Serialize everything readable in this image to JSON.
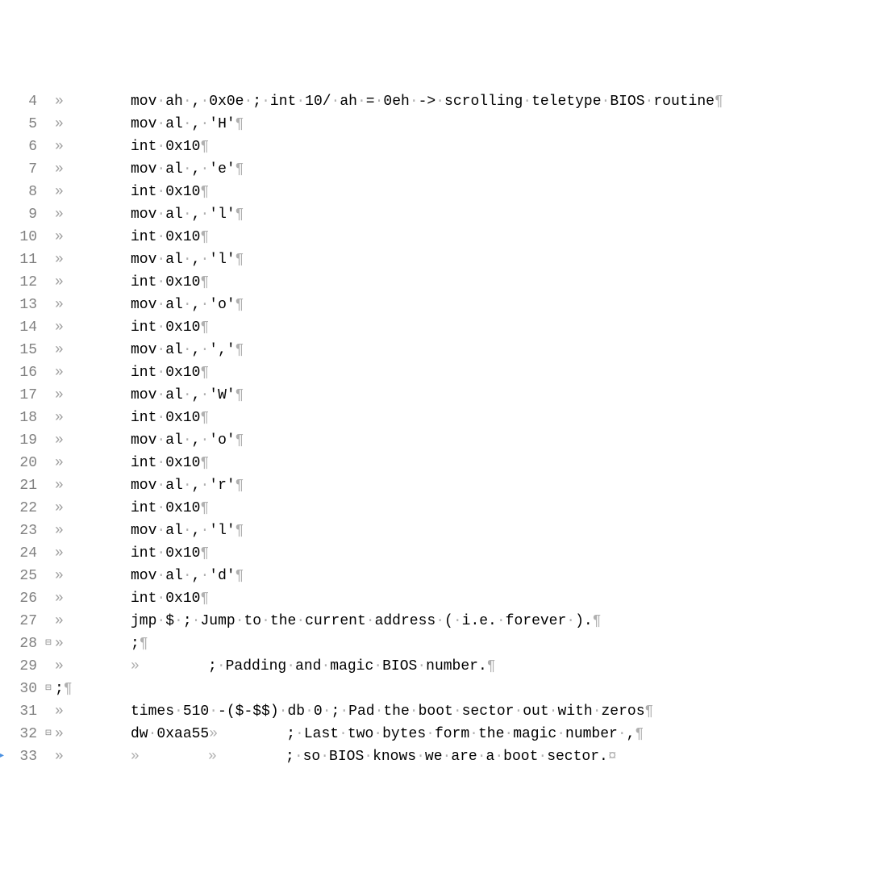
{
  "lines": [
    {
      "num": "4",
      "fold": "",
      "marker": "",
      "tab": "»",
      "tokens": [
        "mov",
        "·",
        "ah",
        "·",
        ",",
        "·",
        "0x0e",
        "·",
        ";",
        "·",
        "int",
        "·",
        "10/",
        "·",
        "ah",
        "·",
        "=",
        "·",
        "0eh",
        "·",
        "->",
        "·",
        "scrolling",
        "·",
        "teletype",
        "·",
        "BIOS",
        "·",
        "routine"
      ],
      "eol": "¶"
    },
    {
      "num": "5",
      "fold": "",
      "marker": "",
      "tab": "»",
      "tokens": [
        "mov",
        "·",
        "al",
        "·",
        ",",
        "·",
        "'H'"
      ],
      "eol": "¶"
    },
    {
      "num": "6",
      "fold": "",
      "marker": "",
      "tab": "»",
      "tokens": [
        "int",
        "·",
        "0x10"
      ],
      "eol": "¶"
    },
    {
      "num": "7",
      "fold": "",
      "marker": "",
      "tab": "»",
      "tokens": [
        "mov",
        "·",
        "al",
        "·",
        ",",
        "·",
        "'e'"
      ],
      "eol": "¶"
    },
    {
      "num": "8",
      "fold": "",
      "marker": "",
      "tab": "»",
      "tokens": [
        "int",
        "·",
        "0x10"
      ],
      "eol": "¶"
    },
    {
      "num": "9",
      "fold": "",
      "marker": "",
      "tab": "»",
      "tokens": [
        "mov",
        "·",
        "al",
        "·",
        ",",
        "·",
        "'l'"
      ],
      "eol": "¶"
    },
    {
      "num": "10",
      "fold": "",
      "marker": "",
      "tab": "»",
      "tokens": [
        "int",
        "·",
        "0x10"
      ],
      "eol": "¶"
    },
    {
      "num": "11",
      "fold": "",
      "marker": "",
      "tab": "»",
      "tokens": [
        "mov",
        "·",
        "al",
        "·",
        ",",
        "·",
        "'l'"
      ],
      "eol": "¶"
    },
    {
      "num": "12",
      "fold": "",
      "marker": "",
      "tab": "»",
      "tokens": [
        "int",
        "·",
        "0x10"
      ],
      "eol": "¶"
    },
    {
      "num": "13",
      "fold": "",
      "marker": "",
      "tab": "»",
      "tokens": [
        "mov",
        "·",
        "al",
        "·",
        ",",
        "·",
        "'o'"
      ],
      "eol": "¶"
    },
    {
      "num": "14",
      "fold": "",
      "marker": "",
      "tab": "»",
      "tokens": [
        "int",
        "·",
        "0x10"
      ],
      "eol": "¶"
    },
    {
      "num": "15",
      "fold": "",
      "marker": "",
      "tab": "»",
      "tokens": [
        "mov",
        "·",
        "al",
        "·",
        ",",
        "·",
        "','"
      ],
      "eol": "¶"
    },
    {
      "num": "16",
      "fold": "",
      "marker": "",
      "tab": "»",
      "tokens": [
        "int",
        "·",
        "0x10"
      ],
      "eol": "¶"
    },
    {
      "num": "17",
      "fold": "",
      "marker": "",
      "tab": "»",
      "tokens": [
        "mov",
        "·",
        "al",
        "·",
        ",",
        "·",
        "'W'"
      ],
      "eol": "¶"
    },
    {
      "num": "18",
      "fold": "",
      "marker": "",
      "tab": "»",
      "tokens": [
        "int",
        "·",
        "0x10"
      ],
      "eol": "¶"
    },
    {
      "num": "19",
      "fold": "",
      "marker": "",
      "tab": "»",
      "tokens": [
        "mov",
        "·",
        "al",
        "·",
        ",",
        "·",
        "'o'"
      ],
      "eol": "¶"
    },
    {
      "num": "20",
      "fold": "",
      "marker": "",
      "tab": "»",
      "tokens": [
        "int",
        "·",
        "0x10"
      ],
      "eol": "¶"
    },
    {
      "num": "21",
      "fold": "",
      "marker": "",
      "tab": "»",
      "tokens": [
        "mov",
        "·",
        "al",
        "·",
        ",",
        "·",
        "'r'"
      ],
      "eol": "¶"
    },
    {
      "num": "22",
      "fold": "",
      "marker": "",
      "tab": "»",
      "tokens": [
        "int",
        "·",
        "0x10"
      ],
      "eol": "¶"
    },
    {
      "num": "23",
      "fold": "",
      "marker": "",
      "tab": "»",
      "tokens": [
        "mov",
        "·",
        "al",
        "·",
        ",",
        "·",
        "'l'"
      ],
      "eol": "¶"
    },
    {
      "num": "24",
      "fold": "",
      "marker": "",
      "tab": "»",
      "tokens": [
        "int",
        "·",
        "0x10"
      ],
      "eol": "¶"
    },
    {
      "num": "25",
      "fold": "",
      "marker": "",
      "tab": "»",
      "tokens": [
        "mov",
        "·",
        "al",
        "·",
        ",",
        "·",
        "'d'"
      ],
      "eol": "¶"
    },
    {
      "num": "26",
      "fold": "",
      "marker": "",
      "tab": "»",
      "tokens": [
        "int",
        "·",
        "0x10"
      ],
      "eol": "¶"
    },
    {
      "num": "27",
      "fold": "",
      "marker": "",
      "tab": "»",
      "tokens": [
        "jmp",
        "·",
        "$",
        "·",
        ";",
        "·",
        "Jump",
        "·",
        "to",
        "·",
        "the",
        "·",
        "current",
        "·",
        "address",
        "·",
        "(",
        "·",
        "i.e.",
        "·",
        "forever",
        "·",
        ")."
      ],
      "eol": "¶"
    },
    {
      "num": "28",
      "fold": "⊟",
      "marker": "",
      "tab": "»",
      "tokens": [
        ";"
      ],
      "eol": "¶"
    },
    {
      "num": "29",
      "fold": "",
      "marker": "",
      "tab": "»",
      "tokens": [
        "»       ",
        ";",
        "·",
        "Padding",
        "·",
        "and",
        "·",
        "magic",
        "·",
        "BIOS",
        "·",
        "number."
      ],
      "eol": "¶",
      "innerTab": true
    },
    {
      "num": "30",
      "fold": "⊟",
      "marker": "",
      "tab": "",
      "tokens": [
        ";"
      ],
      "eol": "¶",
      "noTab": true
    },
    {
      "num": "31",
      "fold": "",
      "marker": "",
      "tab": "»",
      "tokens": [
        "times",
        "·",
        "510",
        "·",
        "-($-$$)",
        "·",
        "db",
        "·",
        "0",
        "·",
        ";",
        "·",
        "Pad",
        "·",
        "the",
        "·",
        "boot",
        "·",
        "sector",
        "·",
        "out",
        "·",
        "with",
        "·",
        "zeros"
      ],
      "eol": "¶"
    },
    {
      "num": "32",
      "fold": "⊟",
      "marker": "",
      "tab": "»",
      "tokens": [
        "dw",
        "·",
        "0xaa55",
        "»      ",
        ";",
        "·",
        "Last",
        "·",
        "two",
        "·",
        "bytes",
        "·",
        "form",
        "·",
        "the",
        "·",
        "magic",
        "·",
        "number",
        "·",
        ","
      ],
      "eol": "¶"
    },
    {
      "num": "33",
      "fold": "",
      "marker": "▸",
      "tab": "»",
      "tokens": [
        "»       ",
        "»       ",
        ";",
        "·",
        "so",
        "·",
        "BIOS",
        "·",
        "knows",
        "·",
        "we",
        "·",
        "are",
        "·",
        "a",
        "·",
        "boot",
        "·",
        "sector."
      ],
      "eol": "¤"
    }
  ]
}
